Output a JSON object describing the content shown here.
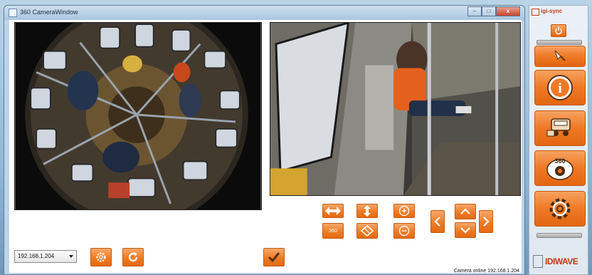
{
  "window": {
    "title": "360 CameraWindow",
    "minimize": "–",
    "maximize": "□",
    "close": "x"
  },
  "toolbar": {
    "address": "192.168.1.204",
    "ptz_360_label": "360"
  },
  "status": {
    "text": "Camera online 192.168.1.204"
  },
  "sidebar": {
    "brand": "igi-sync",
    "info_label": "i",
    "view_360_label": "360",
    "vendor_logo": "IDIWAVE"
  },
  "icons": {
    "settings": "gear-icon",
    "refresh": "refresh-icon",
    "confirm": "checkmark-icon",
    "power": "power-icon",
    "info": "info-icon",
    "car": "car-icon",
    "camera360": "camera-360-icon"
  },
  "colors": {
    "accent": "#ee7926",
    "accent_dark": "#c65a10",
    "brand": "#c23b13"
  }
}
